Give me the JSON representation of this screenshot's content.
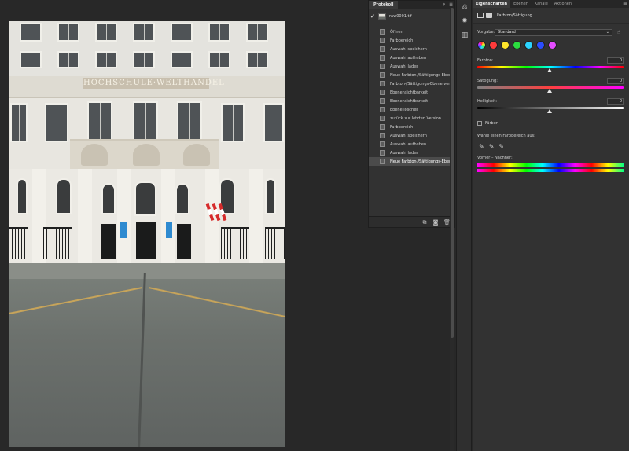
{
  "protokoll": {
    "tab_label": "Protokoll",
    "collapse_icon": "chevron-double-right-icon",
    "menu_icon": "menu-icon",
    "snapshot_name": "raw0001.tif",
    "history": [
      {
        "label": "Öffnen"
      },
      {
        "label": "Farbbereich"
      },
      {
        "label": "Auswahl speichern"
      },
      {
        "label": "Auswahl aufheben"
      },
      {
        "label": "Auswahl laden"
      },
      {
        "label": "Neue Farbton-/Sättigungs-Ebene"
      },
      {
        "label": "Farbton-/Sättigungs-Ebene ver..."
      },
      {
        "label": "Ebenensichtbarkeit"
      },
      {
        "label": "Ebenensichtbarkeit"
      },
      {
        "label": "Ebene löschen"
      },
      {
        "label": "zurück zur letzten Version"
      },
      {
        "label": "Farbbereich"
      },
      {
        "label": "Auswahl speichern"
      },
      {
        "label": "Auswahl aufheben"
      },
      {
        "label": "Auswahl laden"
      },
      {
        "label": "Neue Farbton-/Sättigungs-Ebene"
      }
    ],
    "selected_index": 15
  },
  "photo": {
    "plaque_text": "HOCHSCHULE·WELTHANDEL"
  },
  "properties": {
    "tabs": [
      {
        "label": "Eigenschaften",
        "active": true
      },
      {
        "label": "Ebenen",
        "active": false
      },
      {
        "label": "Kanäle",
        "active": false
      },
      {
        "label": "Aktionen",
        "active": false
      }
    ],
    "adjustment_title": "Farbton/Sättigung",
    "preset_label": "Vorgabe:",
    "preset_value": "Standard",
    "channel_swatches": [
      "#ff3b3b",
      "#ffe52b",
      "#2bdc3f",
      "#2bd4ff",
      "#2b4dff",
      "#e54dff"
    ],
    "sliders": {
      "hue": {
        "label": "Farbton:",
        "value": "0"
      },
      "saturation": {
        "label": "Sättigung:",
        "value": "0"
      },
      "lightness": {
        "label": "Helligkeit:",
        "value": "0"
      }
    },
    "colorize_label": "Färben",
    "pick_range_label": "Wähle einen Farbbereich aus:",
    "before_after_label": "Vorher – Nachher:"
  },
  "colors": {
    "panel_bg": "#323232",
    "app_bg": "#282828",
    "selected_row": "#4b4b4b"
  }
}
